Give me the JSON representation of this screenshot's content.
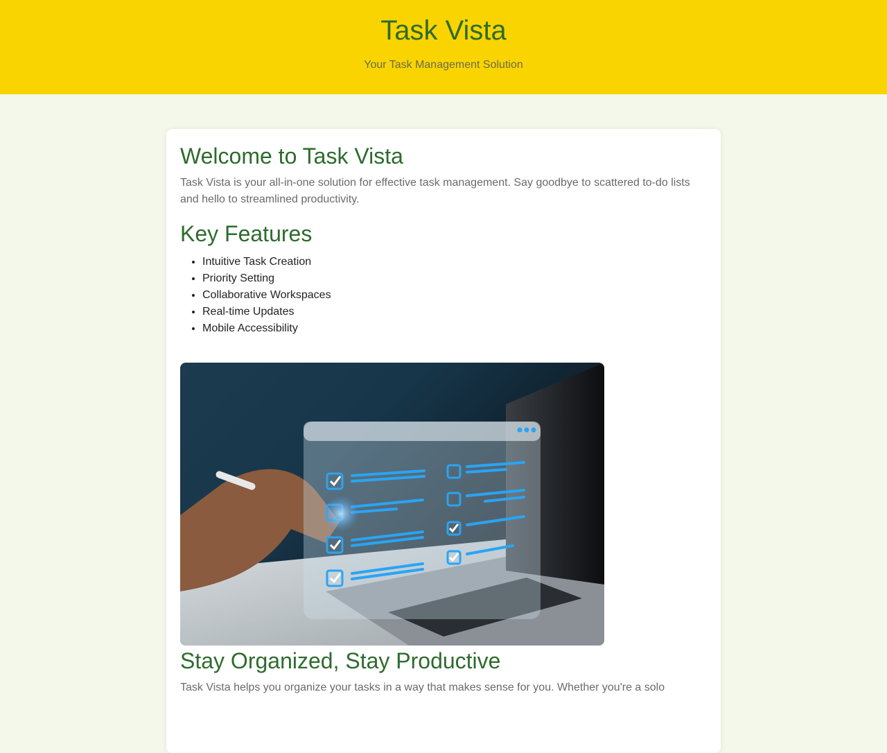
{
  "header": {
    "title": "Task Vista",
    "subtitle": "Your Task Management Solution"
  },
  "welcome": {
    "title": "Welcome to Task Vista",
    "text": "Task Vista is your all-in-one solution for effective task management. Say goodbye to scattered to-do lists and hello to streamlined productivity."
  },
  "features": {
    "title": "Key Features",
    "items": [
      "Intuitive Task Creation",
      "Priority Setting",
      "Collaborative Workspaces",
      "Real-time Updates",
      "Mobile Accessibility"
    ]
  },
  "hero": {
    "icon": "checklist-photo"
  },
  "stay": {
    "title": "Stay Organized, Stay Productive",
    "text": "Task Vista helps you organize your tasks in a way that makes sense for you. Whether you're a solo"
  },
  "colors": {
    "header_bg": "#fad400",
    "accent_green": "#2e6b2e",
    "page_bg": "#f3f8ea"
  }
}
